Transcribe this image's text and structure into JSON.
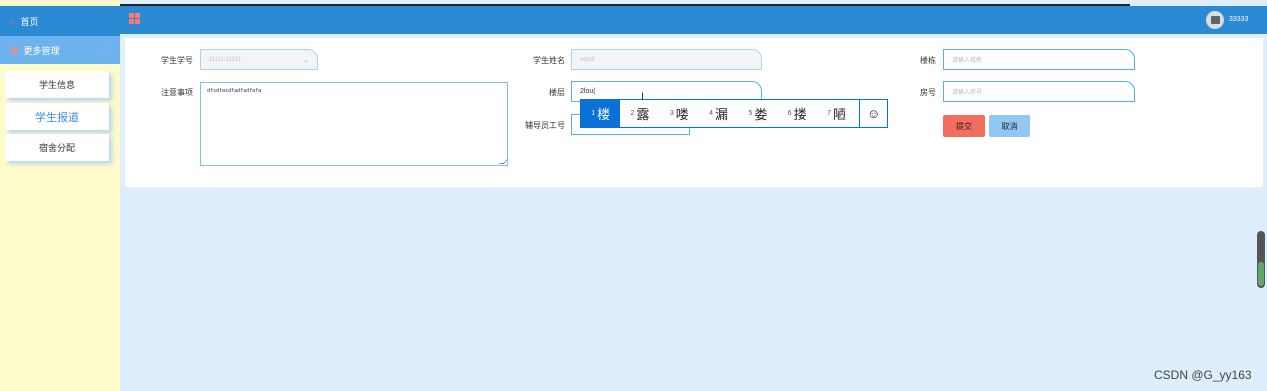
{
  "sidebar": {
    "home_label": "首页",
    "more_label": "更多管理",
    "items": [
      {
        "label": "学生信息"
      },
      {
        "label": "学生报道"
      },
      {
        "label": "宿舍分配"
      }
    ]
  },
  "header": {
    "username": "33333"
  },
  "form": {
    "student_id": {
      "label": "学生学号",
      "value": "11111-11111"
    },
    "student_name": {
      "label": "学生姓名",
      "value": "adsdf"
    },
    "building": {
      "label": "楼栋",
      "placeholder": "请输入楼栋"
    },
    "notes": {
      "label": "注意事项",
      "value": "dfsdfasdfadfadfafa"
    },
    "floor": {
      "label": "楼层",
      "value": "2lou"
    },
    "room": {
      "label": "房号",
      "placeholder": "请输入房号"
    },
    "counselor_id": {
      "label": "辅导员工号"
    },
    "submit_label": "提交",
    "cancel_label": "取消"
  },
  "ime": {
    "candidates": [
      {
        "num": "1",
        "char": "楼"
      },
      {
        "num": "2",
        "char": "露"
      },
      {
        "num": "3",
        "char": "喽"
      },
      {
        "num": "4",
        "char": "漏"
      },
      {
        "num": "5",
        "char": "娄"
      },
      {
        "num": "6",
        "char": "搂"
      },
      {
        "num": "7",
        "char": "陋"
      }
    ],
    "emoji_symbol": "☺"
  },
  "watermark": "CSDN @G_yy163",
  "colors": {
    "header_bg": "#2a8ad4",
    "sidebar_bg": "#fdfbc9",
    "content_bg": "#dfeefc",
    "submit_bg": "#f46e5f",
    "cancel_bg": "#90c8f5",
    "ime_accent": "#0a72d6"
  }
}
